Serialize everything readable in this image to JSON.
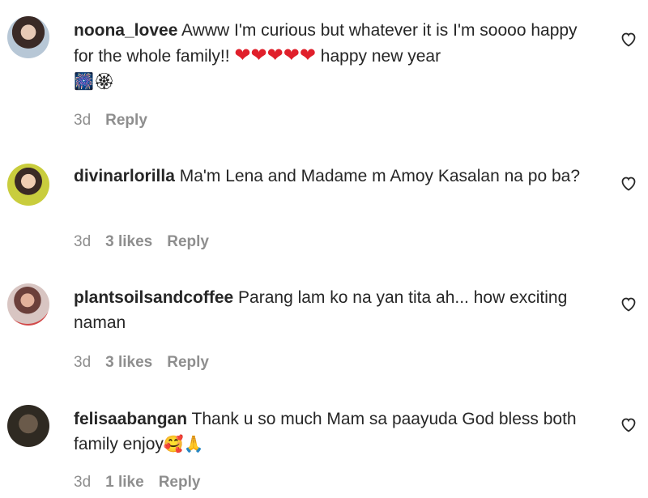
{
  "comments": [
    {
      "username": "noona_lovee",
      "text": " Awww I'm curious but whatever it is I'm soooo happy for the whole family!! ",
      "emoji_hearts": "❤❤❤❤❤",
      "text_after": " happy new year ",
      "emoji_tail": "🎆🏵",
      "time": "3d",
      "likes": "",
      "reply_label": "Reply",
      "avatar_icon": "avatar-woman-icon"
    },
    {
      "username": "divinarlorilla",
      "text": " Ma'm Lena and Madame m Amoy Kasalan na po ba?",
      "time": "3d",
      "likes": "3 likes",
      "reply_label": "Reply",
      "avatar_icon": "avatar-woman-yellow-icon"
    },
    {
      "username": "plantsoilsandcoffee",
      "text": " Parang lam ko na yan tita ah... how exciting naman",
      "time": "3d",
      "likes": "3 likes",
      "reply_label": "Reply",
      "avatar_icon": "avatar-woman-red-icon"
    },
    {
      "username": "felisaabangan",
      "text": " Thank u so much Mam sa paayuda God bless both family enjoy",
      "emoji_tail": "🥰🙏",
      "time": "3d",
      "likes": "1 like",
      "reply_label": "Reply",
      "avatar_icon": "avatar-dark-icon"
    }
  ]
}
